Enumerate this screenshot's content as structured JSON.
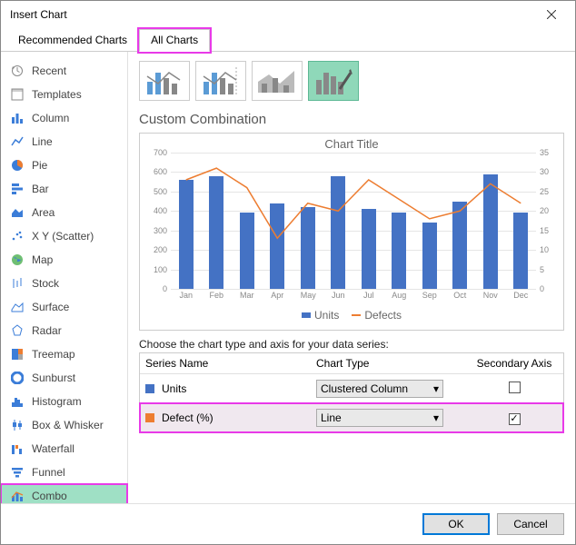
{
  "window": {
    "title": "Insert Chart"
  },
  "tabs": {
    "recommended": "Recommended Charts",
    "all": "All Charts"
  },
  "sidebar": {
    "items": [
      {
        "label": "Recent"
      },
      {
        "label": "Templates"
      },
      {
        "label": "Column"
      },
      {
        "label": "Line"
      },
      {
        "label": "Pie"
      },
      {
        "label": "Bar"
      },
      {
        "label": "Area"
      },
      {
        "label": "X Y (Scatter)"
      },
      {
        "label": "Map"
      },
      {
        "label": "Stock"
      },
      {
        "label": "Surface"
      },
      {
        "label": "Radar"
      },
      {
        "label": "Treemap"
      },
      {
        "label": "Sunburst"
      },
      {
        "label": "Histogram"
      },
      {
        "label": "Box & Whisker"
      },
      {
        "label": "Waterfall"
      },
      {
        "label": "Funnel"
      },
      {
        "label": "Combo"
      }
    ]
  },
  "section_title": "Custom Combination",
  "chart": {
    "title": "Chart Title",
    "legend": {
      "units": "Units",
      "defects": "Defects"
    }
  },
  "chart_data": {
    "type": "combo",
    "categories": [
      "Jan",
      "Feb",
      "Mar",
      "Apr",
      "May",
      "Jun",
      "Jul",
      "Aug",
      "Sep",
      "Oct",
      "Nov",
      "Dec"
    ],
    "series": [
      {
        "name": "Units",
        "type": "bar",
        "axis": "primary",
        "color": "#4472c4",
        "values": [
          560,
          580,
          390,
          440,
          420,
          580,
          410,
          390,
          340,
          450,
          590,
          390
        ]
      },
      {
        "name": "Defects",
        "type": "line",
        "axis": "secondary",
        "color": "#ed7d31",
        "values": [
          28,
          31,
          26,
          13,
          22,
          20,
          28,
          23,
          18,
          20,
          27,
          22
        ]
      }
    ],
    "y_primary": {
      "min": 0,
      "max": 700,
      "step": 100
    },
    "y_secondary": {
      "min": 0,
      "max": 35,
      "step": 5
    }
  },
  "series_prompt": "Choose the chart type and axis for your data series:",
  "series_table": {
    "headers": {
      "name": "Series Name",
      "type": "Chart Type",
      "sec": "Secondary Axis"
    },
    "rows": [
      {
        "name": "Units",
        "color": "#4472c4",
        "type": "Clustered Column",
        "secondary": false
      },
      {
        "name": "Defect (%)",
        "color": "#ed7d31",
        "type": "Line",
        "secondary": true
      }
    ]
  },
  "footer": {
    "ok": "OK",
    "cancel": "Cancel"
  }
}
